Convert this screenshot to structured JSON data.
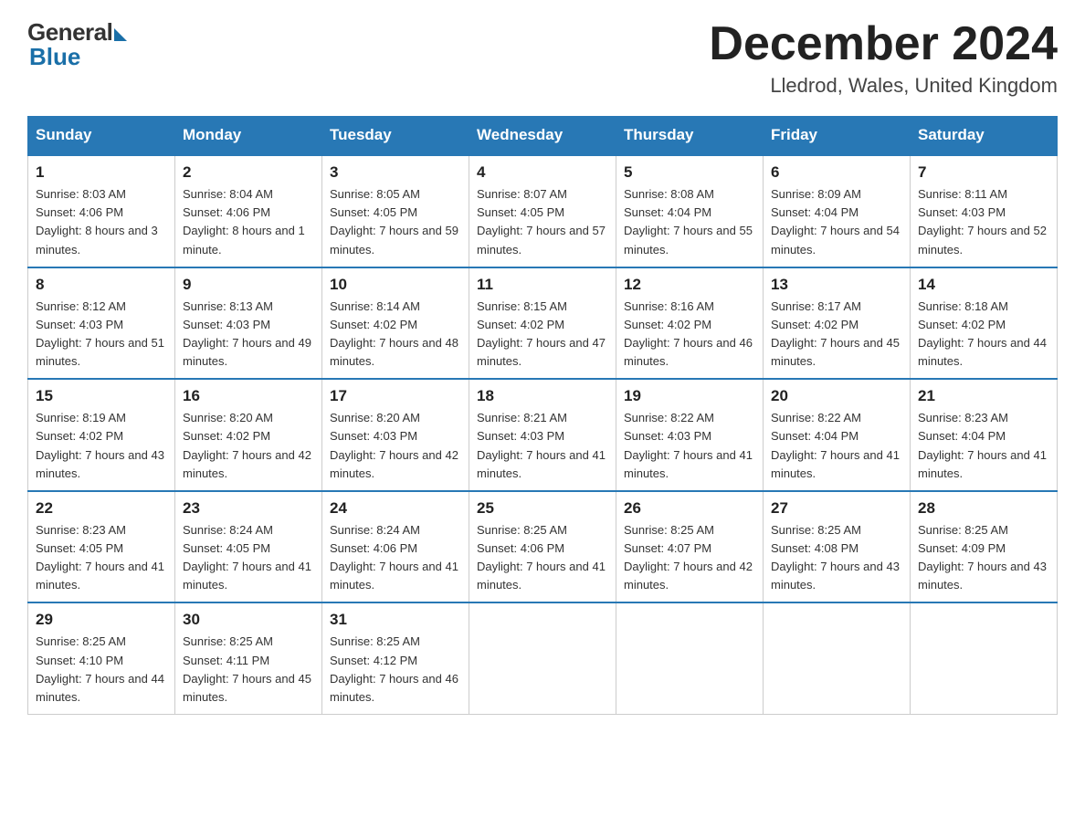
{
  "logo": {
    "general": "General",
    "blue": "Blue"
  },
  "header": {
    "title": "December 2024",
    "location": "Lledrod, Wales, United Kingdom"
  },
  "weekdays": [
    "Sunday",
    "Monday",
    "Tuesday",
    "Wednesday",
    "Thursday",
    "Friday",
    "Saturday"
  ],
  "weeks": [
    [
      {
        "day": "1",
        "sunrise": "8:03 AM",
        "sunset": "4:06 PM",
        "daylight": "8 hours and 3 minutes."
      },
      {
        "day": "2",
        "sunrise": "8:04 AM",
        "sunset": "4:06 PM",
        "daylight": "8 hours and 1 minute."
      },
      {
        "day": "3",
        "sunrise": "8:05 AM",
        "sunset": "4:05 PM",
        "daylight": "7 hours and 59 minutes."
      },
      {
        "day": "4",
        "sunrise": "8:07 AM",
        "sunset": "4:05 PM",
        "daylight": "7 hours and 57 minutes."
      },
      {
        "day": "5",
        "sunrise": "8:08 AM",
        "sunset": "4:04 PM",
        "daylight": "7 hours and 55 minutes."
      },
      {
        "day": "6",
        "sunrise": "8:09 AM",
        "sunset": "4:04 PM",
        "daylight": "7 hours and 54 minutes."
      },
      {
        "day": "7",
        "sunrise": "8:11 AM",
        "sunset": "4:03 PM",
        "daylight": "7 hours and 52 minutes."
      }
    ],
    [
      {
        "day": "8",
        "sunrise": "8:12 AM",
        "sunset": "4:03 PM",
        "daylight": "7 hours and 51 minutes."
      },
      {
        "day": "9",
        "sunrise": "8:13 AM",
        "sunset": "4:03 PM",
        "daylight": "7 hours and 49 minutes."
      },
      {
        "day": "10",
        "sunrise": "8:14 AM",
        "sunset": "4:02 PM",
        "daylight": "7 hours and 48 minutes."
      },
      {
        "day": "11",
        "sunrise": "8:15 AM",
        "sunset": "4:02 PM",
        "daylight": "7 hours and 47 minutes."
      },
      {
        "day": "12",
        "sunrise": "8:16 AM",
        "sunset": "4:02 PM",
        "daylight": "7 hours and 46 minutes."
      },
      {
        "day": "13",
        "sunrise": "8:17 AM",
        "sunset": "4:02 PM",
        "daylight": "7 hours and 45 minutes."
      },
      {
        "day": "14",
        "sunrise": "8:18 AM",
        "sunset": "4:02 PM",
        "daylight": "7 hours and 44 minutes."
      }
    ],
    [
      {
        "day": "15",
        "sunrise": "8:19 AM",
        "sunset": "4:02 PM",
        "daylight": "7 hours and 43 minutes."
      },
      {
        "day": "16",
        "sunrise": "8:20 AM",
        "sunset": "4:02 PM",
        "daylight": "7 hours and 42 minutes."
      },
      {
        "day": "17",
        "sunrise": "8:20 AM",
        "sunset": "4:03 PM",
        "daylight": "7 hours and 42 minutes."
      },
      {
        "day": "18",
        "sunrise": "8:21 AM",
        "sunset": "4:03 PM",
        "daylight": "7 hours and 41 minutes."
      },
      {
        "day": "19",
        "sunrise": "8:22 AM",
        "sunset": "4:03 PM",
        "daylight": "7 hours and 41 minutes."
      },
      {
        "day": "20",
        "sunrise": "8:22 AM",
        "sunset": "4:04 PM",
        "daylight": "7 hours and 41 minutes."
      },
      {
        "day": "21",
        "sunrise": "8:23 AM",
        "sunset": "4:04 PM",
        "daylight": "7 hours and 41 minutes."
      }
    ],
    [
      {
        "day": "22",
        "sunrise": "8:23 AM",
        "sunset": "4:05 PM",
        "daylight": "7 hours and 41 minutes."
      },
      {
        "day": "23",
        "sunrise": "8:24 AM",
        "sunset": "4:05 PM",
        "daylight": "7 hours and 41 minutes."
      },
      {
        "day": "24",
        "sunrise": "8:24 AM",
        "sunset": "4:06 PM",
        "daylight": "7 hours and 41 minutes."
      },
      {
        "day": "25",
        "sunrise": "8:25 AM",
        "sunset": "4:06 PM",
        "daylight": "7 hours and 41 minutes."
      },
      {
        "day": "26",
        "sunrise": "8:25 AM",
        "sunset": "4:07 PM",
        "daylight": "7 hours and 42 minutes."
      },
      {
        "day": "27",
        "sunrise": "8:25 AM",
        "sunset": "4:08 PM",
        "daylight": "7 hours and 43 minutes."
      },
      {
        "day": "28",
        "sunrise": "8:25 AM",
        "sunset": "4:09 PM",
        "daylight": "7 hours and 43 minutes."
      }
    ],
    [
      {
        "day": "29",
        "sunrise": "8:25 AM",
        "sunset": "4:10 PM",
        "daylight": "7 hours and 44 minutes."
      },
      {
        "day": "30",
        "sunrise": "8:25 AM",
        "sunset": "4:11 PM",
        "daylight": "7 hours and 45 minutes."
      },
      {
        "day": "31",
        "sunrise": "8:25 AM",
        "sunset": "4:12 PM",
        "daylight": "7 hours and 46 minutes."
      },
      null,
      null,
      null,
      null
    ]
  ],
  "labels": {
    "sunrise": "Sunrise:",
    "sunset": "Sunset:",
    "daylight": "Daylight:"
  }
}
